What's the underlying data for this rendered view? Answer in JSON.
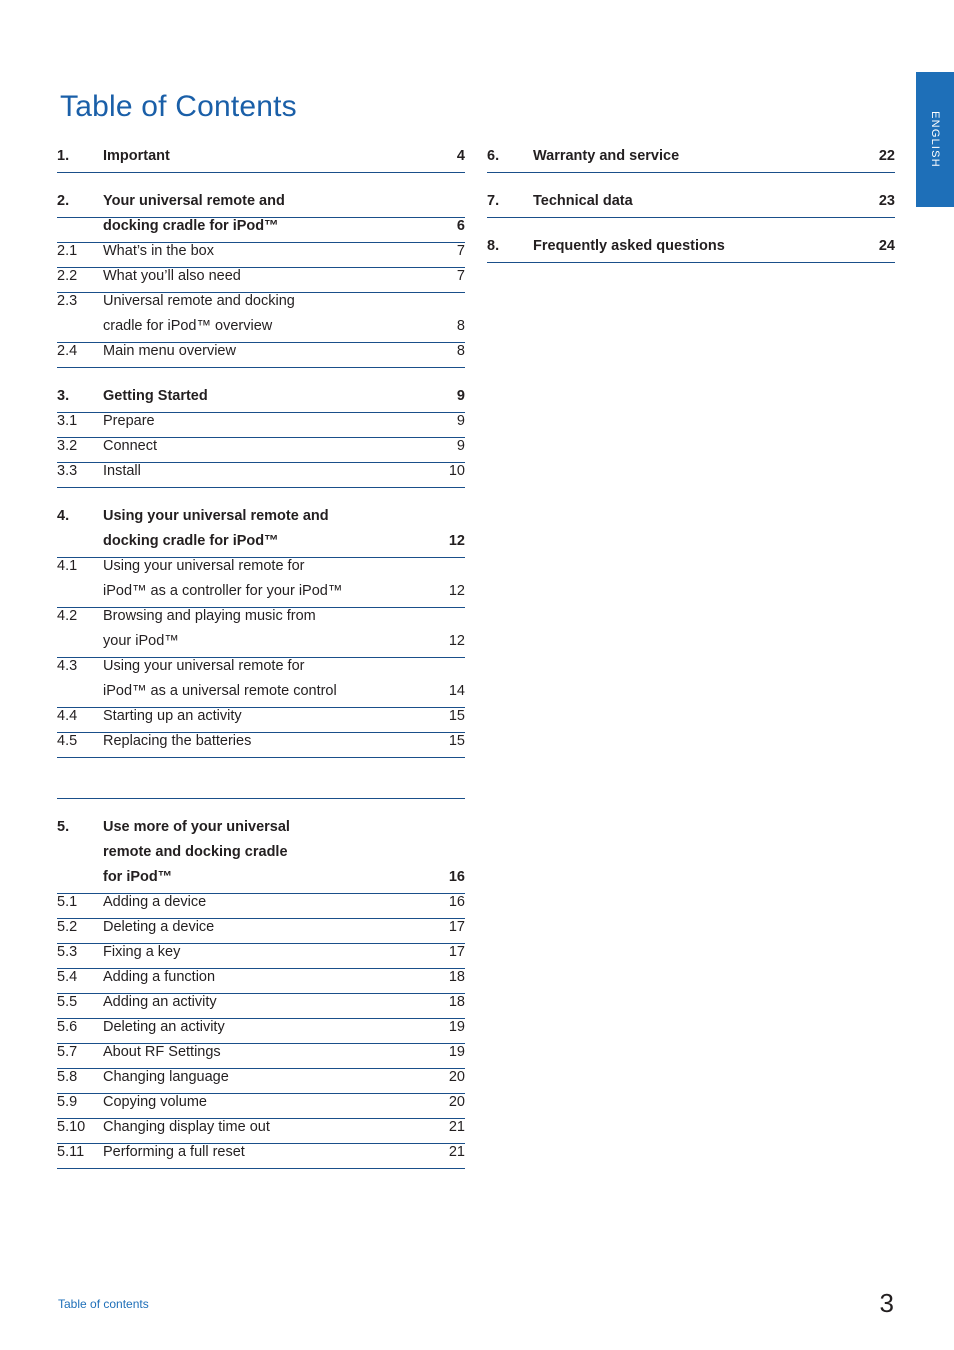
{
  "side_tab": {
    "label": "ENGLISH",
    "color": "#1e6fb8"
  },
  "page_title": "Table of Contents",
  "footer": {
    "label": "Table of contents",
    "page_number": "3"
  },
  "toc": {
    "left_column": [
      {
        "type": "chapter",
        "num": "1.",
        "title": "Important",
        "page": "4"
      },
      {
        "type": "gap"
      },
      {
        "type": "chapter",
        "num": "2.",
        "title": "Your universal remote and",
        "page": ""
      },
      {
        "type": "chapter-cont",
        "num": "",
        "title": "docking cradle for iPod™",
        "page": "6"
      },
      {
        "type": "item",
        "num": "2.1",
        "title": "What’s in the box",
        "page": "7"
      },
      {
        "type": "item",
        "num": "2.2",
        "title": "What you’ll also need",
        "page": "7"
      },
      {
        "type": "item-noline",
        "num": "2.3",
        "title": "Universal remote and docking",
        "page": ""
      },
      {
        "type": "item-cont",
        "num": "",
        "title": "cradle for iPod™ overview",
        "page": "8"
      },
      {
        "type": "item",
        "num": "2.4",
        "title": "Main menu overview",
        "page": "8"
      },
      {
        "type": "gap"
      },
      {
        "type": "chapter",
        "num": "3.",
        "title": "Getting Started",
        "page": "9"
      },
      {
        "type": "item",
        "num": "3.1",
        "title": "Prepare",
        "page": "9"
      },
      {
        "type": "item",
        "num": "3.2",
        "title": "Connect",
        "page": "9"
      },
      {
        "type": "item",
        "num": "3.3",
        "title": "Install",
        "page": "10"
      },
      {
        "type": "gap"
      },
      {
        "type": "chapter-noline",
        "num": "4.",
        "title": "Using your universal remote and",
        "page": ""
      },
      {
        "type": "chapter-cont",
        "num": "",
        "title": "docking cradle for iPod™",
        "page": "12"
      },
      {
        "type": "item-noline",
        "num": "4.1",
        "title": "Using your universal remote for",
        "page": ""
      },
      {
        "type": "item-cont",
        "num": "",
        "title": "iPod™ as a controller for your iPod™",
        "page": "12"
      },
      {
        "type": "item-noline",
        "num": "4.2",
        "title": "Browsing and playing music from",
        "page": ""
      },
      {
        "type": "item-cont",
        "num": "",
        "title": "your iPod™",
        "page": "12"
      },
      {
        "type": "item-noline",
        "num": "4.3",
        "title": "Using your universal remote for",
        "page": ""
      },
      {
        "type": "item-cont",
        "num": "",
        "title": "iPod™ as a universal remote control",
        "page": "14"
      },
      {
        "type": "item",
        "num": "4.4",
        "title": "Starting up an activity",
        "page": "15"
      },
      {
        "type": "item",
        "num": "4.5",
        "title": "Replacing the batteries",
        "page": "15"
      },
      {
        "type": "gap-line"
      },
      {
        "type": "chapter-noline",
        "num": "5.",
        "title": "Use more of your universal",
        "page": ""
      },
      {
        "type": "chapter-cont-noline",
        "num": "",
        "title": "remote and docking cradle",
        "page": ""
      },
      {
        "type": "chapter-cont",
        "num": "",
        "title": "for iPod™",
        "page": "16"
      },
      {
        "type": "item",
        "num": "5.1",
        "title": "Adding a device",
        "page": "16"
      },
      {
        "type": "item",
        "num": "5.2",
        "title": "Deleting a device",
        "page": "17"
      },
      {
        "type": "item",
        "num": "5.3",
        "title": "Fixing a key",
        "page": "17"
      },
      {
        "type": "item",
        "num": "5.4",
        "title": "Adding a function",
        "page": "18"
      },
      {
        "type": "item",
        "num": "5.5",
        "title": "Adding an activity",
        "page": "18"
      },
      {
        "type": "item",
        "num": "5.6",
        "title": "Deleting an activity",
        "page": "19"
      },
      {
        "type": "item",
        "num": "5.7",
        "title": "About RF Settings",
        "page": "19"
      },
      {
        "type": "item",
        "num": "5.8",
        "title": "Changing language",
        "page": "20"
      },
      {
        "type": "item",
        "num": "5.9",
        "title": "Copying volume",
        "page": "20"
      },
      {
        "type": "item",
        "num": "5.10",
        "title": "Changing display time out",
        "page": "21"
      },
      {
        "type": "item",
        "num": "5.11",
        "title": "Performing a full reset",
        "page": "21"
      }
    ],
    "right_column": [
      {
        "type": "chapter",
        "num": "6.",
        "title": "Warranty and service",
        "page": "22"
      },
      {
        "type": "gap"
      },
      {
        "type": "chapter",
        "num": "7.",
        "title": "Technical data",
        "page": "23"
      },
      {
        "type": "gap"
      },
      {
        "type": "chapter",
        "num": "8.",
        "title": "Frequently asked questions",
        "page": "24"
      }
    ]
  }
}
